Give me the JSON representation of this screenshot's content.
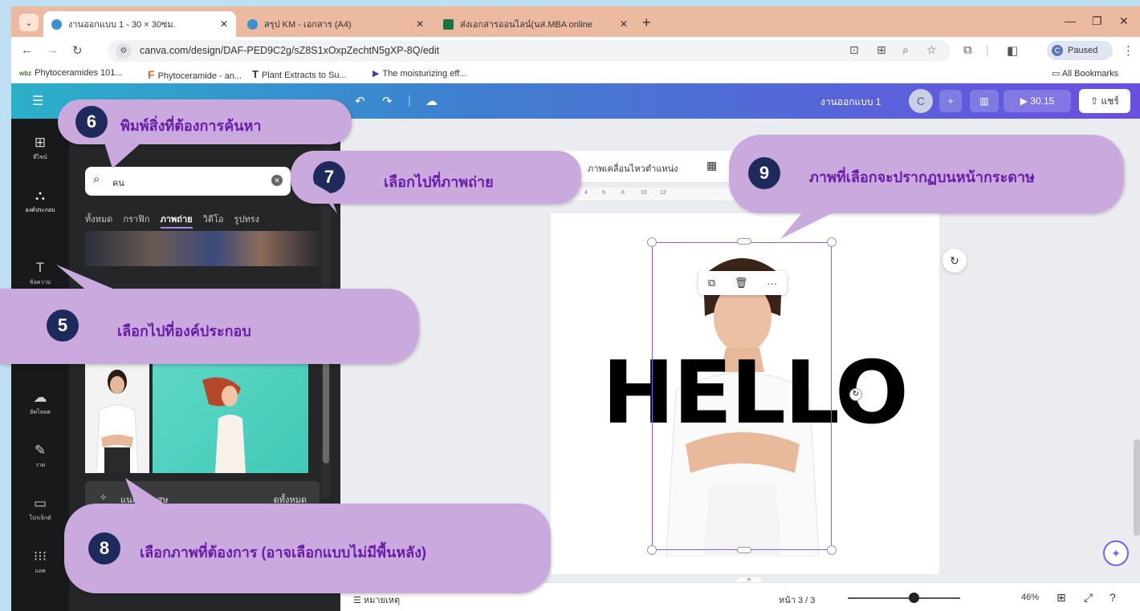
{
  "browser": {
    "tabs": [
      {
        "title": "งานออกแบบ 1 - 30 × 30ซม.",
        "active": true
      },
      {
        "title": "สรุป KM - เอกสาร (A4)",
        "active": false
      },
      {
        "title": "ส่งเอกสารออนไลน์(นส.MBA online",
        "active": false
      }
    ],
    "url": "canva.com/design/DAF-PED9C2g/sZ8S1xOxpZechtN5gXP-8Q/edit",
    "profile_initial": "C",
    "profile_status": "Paused",
    "bookmarks": [
      {
        "icon": "wbz",
        "label": "Phytoceramides 101..."
      },
      {
        "icon": "F",
        "label": "Phytoceramide - an..."
      },
      {
        "icon": "T",
        "label": "Plant Extracts to Su..."
      },
      {
        "icon": "▶",
        "label": "The moisturizing eff..."
      }
    ],
    "all_bookmarks": "All Bookmarks"
  },
  "canva": {
    "title": "งานออกแบบ 1",
    "user_initial": "C",
    "time": "30.15",
    "share": "แชร์",
    "rail": [
      {
        "icon": "template-icon",
        "label": "ดีไซน์"
      },
      {
        "icon": "elements-icon",
        "label": "องค์ประกอบ",
        "selected": true
      },
      {
        "icon": "text-icon",
        "label": "ข้อความ"
      },
      {
        "icon": "upload-icon",
        "label": "อัพโหลด"
      },
      {
        "icon": "draw-icon",
        "label": "วาด"
      },
      {
        "icon": "folder-icon",
        "label": "โปรเจ็กต์"
      },
      {
        "icon": "apps-icon",
        "label": "แอพ"
      }
    ],
    "search_value": "คน",
    "categories": [
      "ทั้งหมด",
      "กราฟิก",
      "ภาพถ่าย",
      "วิดีโอ",
      "รูปทรง"
    ],
    "active_category": "ภาพถ่าย",
    "gen_label": "แนะนำพิเศษ",
    "gen_right": "ดูทั้งหมด",
    "toolbar": {
      "item1": "ภาพเคลื่อนไหว",
      "item2": "ตำแหน่ง"
    },
    "ruler_ticks": [
      "4",
      "6",
      "8",
      "10",
      "12"
    ],
    "canvas_text": "HELLO",
    "footer": {
      "notes": "หมายเหตุ",
      "page": "หน้า 3 / 3",
      "zoom": "46%",
      "zoom_fraction": 0.54
    }
  },
  "callouts": [
    {
      "num": "5",
      "text": "เลือกไปที่องค์ประกอบ"
    },
    {
      "num": "6",
      "text": "พิมพ์สิ่งที่ต้องการค้นหา"
    },
    {
      "num": "7",
      "text": "เลือกไปที่ภาพถ่าย"
    },
    {
      "num": "8",
      "text": "เลือกภาพที่ต้องการ (อาจเลือกแบบไม่มีพื้นหลัง)"
    },
    {
      "num": "9",
      "text": "ภาพที่เลือกจะปรากฏบนหน้ากระดาษ"
    }
  ],
  "colors": {
    "callout_bg": "#c9a9de",
    "callout_text": "#6a1ea8",
    "number_bg": "#1f2a5c",
    "selection": "#8b5cf6"
  }
}
